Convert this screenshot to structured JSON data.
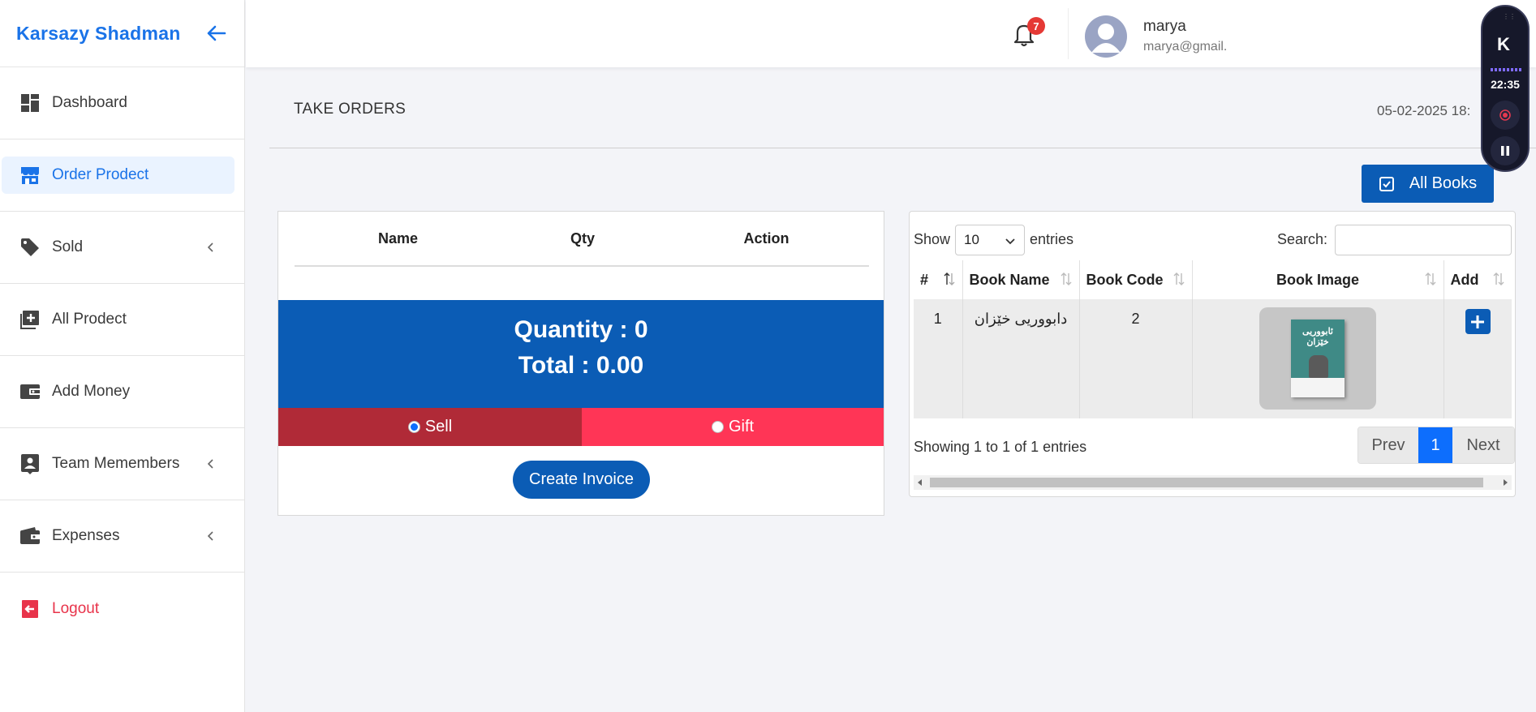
{
  "brand": {
    "name": "Karsazy Shadman"
  },
  "sidebar": {
    "items": [
      {
        "label": "Dashboard",
        "icon": "dashboard-icon"
      },
      {
        "label": "Order Prodect",
        "icon": "store-icon",
        "active": true
      },
      {
        "label": "Sold",
        "icon": "tag-icon",
        "has_submenu": true
      },
      {
        "label": "All Prodect",
        "icon": "add-box-icon"
      },
      {
        "label": "Add Money",
        "icon": "wallet-icon"
      },
      {
        "label": "Team Memembers",
        "icon": "person-card-icon",
        "has_submenu": true
      },
      {
        "label": "Expenses",
        "icon": "wallet-icon",
        "has_submenu": true
      },
      {
        "label": "Logout",
        "icon": "logout-icon"
      }
    ]
  },
  "header": {
    "notification_count": "7",
    "user_name": "marya",
    "user_email": "marya@gmail."
  },
  "page": {
    "title": "TAKE ORDERS",
    "date": "05-02-2025 18:"
  },
  "all_books_label": "All Books",
  "order": {
    "columns": [
      "Name",
      "Qty",
      "Action"
    ],
    "quantity_text": "Quantity : 0",
    "total_text": "Total : 0.00",
    "sell_label": "Sell",
    "gift_label": "Gift",
    "selected_type": "sell",
    "create_label": "Create Invoice"
  },
  "books": {
    "show_label": "Show",
    "page_length": "10",
    "entries_label": "entries",
    "search_label": "Search:",
    "search_value": "",
    "columns": [
      "#",
      "Book Name",
      "Book Code",
      "Book Image",
      "Add"
    ],
    "rows": [
      {
        "num": "1",
        "name": "دابووریی خێزان",
        "code": "2",
        "cover_title": "ئابووریی خێزان"
      }
    ],
    "info": "Showing 1 to 1 of 1 entries",
    "prev_label": "Prev",
    "current_page": "1",
    "next_label": "Next"
  },
  "recorder": {
    "time": "22:35",
    "logo": "K"
  },
  "colors": {
    "brand_blue": "#1a73e8",
    "primary": "#0b5cb5",
    "sell": "#b02a37",
    "gift": "#ff3556",
    "logout": "#e8334a"
  }
}
